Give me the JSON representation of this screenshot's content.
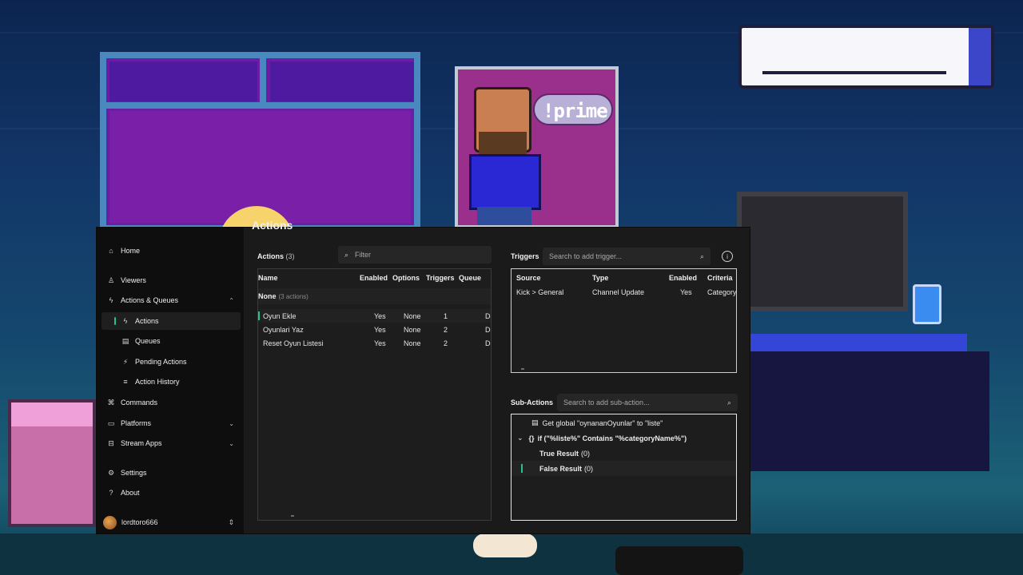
{
  "background": {
    "poster_text": "!prime"
  },
  "page": {
    "title": "Actions"
  },
  "sidebar": {
    "items": [
      {
        "label": "Home",
        "icon": "home-icon"
      },
      {
        "label": "Viewers",
        "icon": "users-icon"
      },
      {
        "label": "Actions & Queues",
        "icon": "bolt-icon"
      },
      {
        "label": "Actions",
        "icon": "bolt-icon"
      },
      {
        "label": "Queues",
        "icon": "queue-icon"
      },
      {
        "label": "Pending Actions",
        "icon": "pending-icon"
      },
      {
        "label": "Action History",
        "icon": "history-icon"
      },
      {
        "label": "Commands",
        "icon": "command-icon"
      },
      {
        "label": "Platforms",
        "icon": "platforms-icon"
      },
      {
        "label": "Stream Apps",
        "icon": "apps-icon"
      },
      {
        "label": "Settings",
        "icon": "gear-icon"
      },
      {
        "label": "About",
        "icon": "question-icon"
      }
    ],
    "user": {
      "name": "lordtoro666"
    }
  },
  "actions_panel": {
    "title": "Actions",
    "count": "(3)",
    "filter_placeholder": "Filter",
    "columns": [
      "Name",
      "Enabled",
      "Options",
      "Triggers",
      "Queue"
    ],
    "group": {
      "name": "None",
      "count": "(3 actions)"
    },
    "rows": [
      {
        "name": "Oyun Ekle",
        "enabled": "Yes",
        "options": "None",
        "triggers": "1",
        "queue": "De"
      },
      {
        "name": "Oyunlari Yaz",
        "enabled": "Yes",
        "options": "None",
        "triggers": "2",
        "queue": "De"
      },
      {
        "name": "Reset Oyun Listesi",
        "enabled": "Yes",
        "options": "None",
        "triggers": "2",
        "queue": "De"
      }
    ]
  },
  "triggers_panel": {
    "title": "Triggers",
    "search_placeholder": "Search to add trigger...",
    "columns": [
      "Source",
      "Type",
      "Enabled",
      "Criteria"
    ],
    "rows": [
      {
        "source": "Kick > General",
        "type": "Channel Update",
        "enabled": "Yes",
        "criteria": "Category"
      }
    ]
  },
  "subactions_panel": {
    "title": "Sub-Actions",
    "search_placeholder": "Search to add sub-action...",
    "items": [
      {
        "text": "Get global \"oynananOyunlar\" to \"liste\""
      },
      {
        "prefix": "{}",
        "text": "if (\"%liste%\" Contains \"%categoryName%\")"
      },
      {
        "label": "True Result",
        "count": "(0)"
      },
      {
        "label": "False Result",
        "count": "(0)"
      }
    ]
  },
  "colors": {
    "accent": "#21c48a",
    "app_bg": "#1a1a1a",
    "sidebar_bg": "#0e0e0e"
  }
}
